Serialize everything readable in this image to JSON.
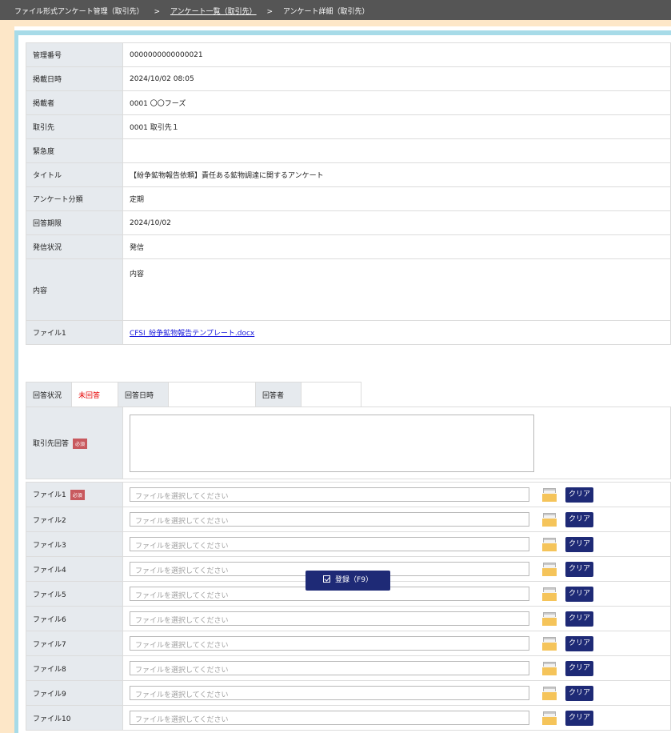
{
  "breadcrumb": {
    "item1": "ファイル形式アンケート管理（取引先）",
    "sep": ">",
    "item2": "アンケート一覧（取引先）",
    "item3": "アンケート詳細（取引先）"
  },
  "info": {
    "rows": [
      {
        "label": "管理番号",
        "value": "0000000000000021"
      },
      {
        "label": "掲載日時",
        "value": "2024/10/02 08:05"
      },
      {
        "label": "掲載者",
        "value": "0001 〇〇フーズ"
      },
      {
        "label": "取引先",
        "value": "0001 取引先１"
      },
      {
        "label": "緊急度",
        "value": ""
      },
      {
        "label": "タイトル",
        "value": "【紛争鉱物報告依頼】責任ある鉱物調達に関するアンケート"
      },
      {
        "label": "アンケート分類",
        "value": "定期"
      },
      {
        "label": "回答期限",
        "value": "2024/10/02"
      },
      {
        "label": "発信状況",
        "value": "発信"
      },
      {
        "label": "内容",
        "value": "内容"
      },
      {
        "label": "ファイル1",
        "value": "CFSI_紛争鉱物報告テンプレート.docx"
      }
    ]
  },
  "status": {
    "answer_status_label": "回答状況",
    "answer_status_value": "未回答",
    "answer_date_label": "回答日時",
    "answer_date_value": "",
    "respondent_label": "回答者",
    "respondent_value": ""
  },
  "answer": {
    "label": "取引先回答",
    "required": "必須"
  },
  "files": {
    "placeholder": "ファイルを選択してください",
    "clear_label": "クリア",
    "required": "必須",
    "labels": [
      "ファイル1",
      "ファイル2",
      "ファイル3",
      "ファイル4",
      "ファイル5",
      "ファイル6",
      "ファイル7",
      "ファイル8",
      "ファイル9",
      "ファイル10"
    ]
  },
  "submit": {
    "label": "登録（F9）"
  },
  "colors": {
    "header_bg": "#555555",
    "page_bg": "#fde7c8",
    "accent_stripe": "#a7dbe8",
    "label_bg": "#e6eaee",
    "button_navy": "#1e2a76",
    "required_badge": "#c8595e",
    "unanswered_red": "#e60000",
    "link_blue": "#1a1adc"
  },
  "icons": {
    "file_picker": "folder-icon",
    "submit": "checkbox-icon"
  }
}
